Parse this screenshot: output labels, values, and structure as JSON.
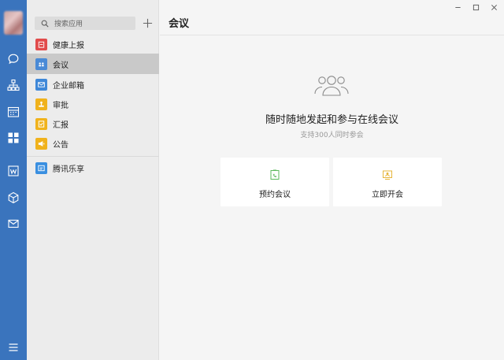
{
  "search": {
    "placeholder": "搜索应用"
  },
  "sidebar": {
    "items": [
      {
        "label": "健康上报",
        "icon": "health-report-icon",
        "color": "#e14b4b"
      },
      {
        "label": "会议",
        "icon": "meeting-icon",
        "color": "#4a8ad6"
      },
      {
        "label": "企业邮箱",
        "icon": "mail-icon",
        "color": "#3f88d8"
      },
      {
        "label": "审批",
        "icon": "approval-icon",
        "color": "#f0b21c"
      },
      {
        "label": "汇报",
        "icon": "report-icon",
        "color": "#f0b21c"
      },
      {
        "label": "公告",
        "icon": "announcement-icon",
        "color": "#f0b21c"
      },
      {
        "label": "腾讯乐享",
        "icon": "tencent-lexiang-icon",
        "color": "#3a8fe0"
      }
    ],
    "active_index": 1
  },
  "main": {
    "title": "会议",
    "headline": "随时随地发起和参与在线会议",
    "subline": "支持300人同时参会",
    "cards": [
      {
        "label": "预约会议",
        "icon": "schedule-meeting-icon",
        "color": "#5cb85c"
      },
      {
        "label": "立即开会",
        "icon": "start-meeting-icon",
        "color": "#e6b53a"
      }
    ]
  },
  "colors": {
    "rail": "#3a74bd",
    "sidebar_bg": "#ececec",
    "active_item": "#c9c9c9",
    "main_bg": "#f5f5f5"
  }
}
